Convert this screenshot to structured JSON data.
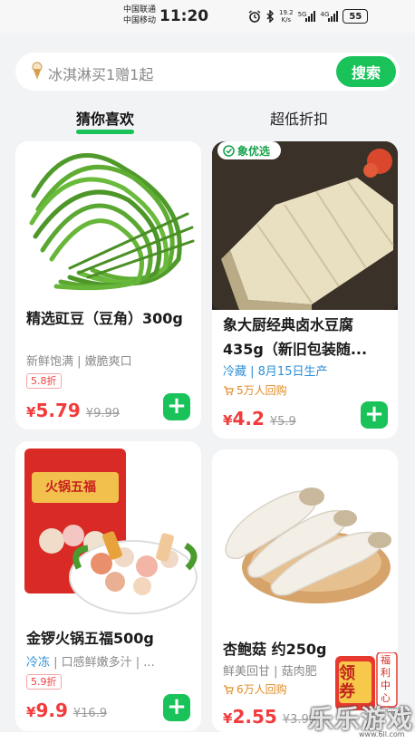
{
  "status_bar": {
    "carrier_1": "中国联通",
    "carrier_2": "中国移动",
    "time": "11:20",
    "net_speed_value": "19.2",
    "net_speed_unit": "K/s",
    "signal_1_tag": "5G",
    "signal_2_tag": "4G",
    "battery": "55"
  },
  "search": {
    "placeholder": "冰淇淋买1赠1起",
    "button_label": "搜索"
  },
  "tabs": [
    {
      "label": "猜你喜欢",
      "active": true
    },
    {
      "label": "超低折扣",
      "active": false
    }
  ],
  "products": [
    {
      "title": "精选豇豆（豆角）300g",
      "subtitle": "新鲜饱满 | 嫩脆爽口",
      "discount": "5.8折",
      "currency": "¥",
      "price": "5.79",
      "original_price": "¥9.99"
    },
    {
      "title": "象大厨经典卤水豆腐435g（新旧包装随...",
      "badge": "象优选",
      "subtitle_tag": "冷藏",
      "subtitle": " | 8月15日生产",
      "buy_count": "5万人回购",
      "currency": "¥",
      "price": "4.2",
      "original_price": "¥5.9"
    },
    {
      "title": "金锣火锅五福500g",
      "subtitle_tag": "冷冻",
      "subtitle": " | 口感鲜嫩多汁 | ...",
      "discount": "5.9折",
      "currency": "¥",
      "price": "9.9",
      "original_price": "¥16.9",
      "package_text": "火锅五福"
    },
    {
      "title": "杏鲍菇 约250g",
      "subtitle": "鲜美回甘 | 菇肉肥",
      "buy_count": "6万人回购",
      "currency": "¥",
      "price": "2.55",
      "original_price": "¥3.99"
    }
  ],
  "float_badge": {
    "big_text": "领券",
    "side_text": "福利中心"
  },
  "watermark": {
    "text": "乐乐游戏",
    "url": "www.6ll.com"
  },
  "colors": {
    "accent_green": "#19c35a",
    "price_red": "#f23b3b",
    "tag_blue": "#2d8fd8",
    "buy_orange": "#e08a25"
  }
}
